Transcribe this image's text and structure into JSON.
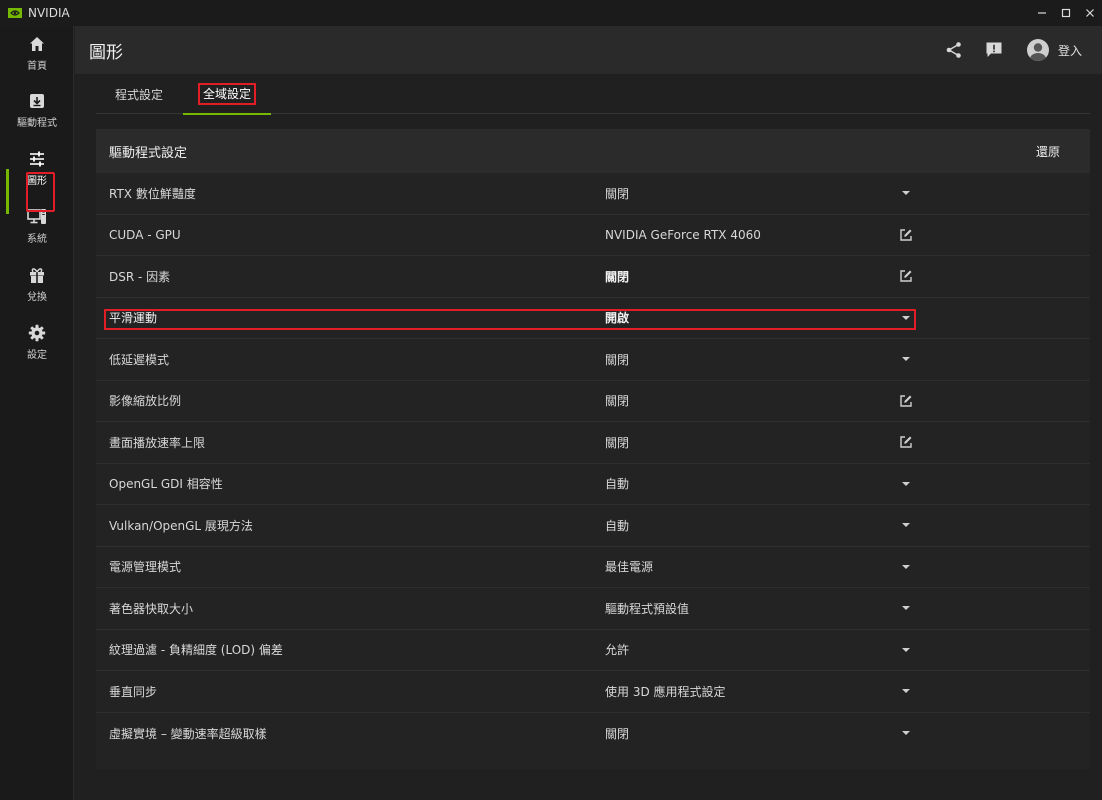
{
  "titlebar": {
    "app_name": "NVIDIA"
  },
  "sidebar": {
    "items": [
      {
        "label": "首頁",
        "icon": "home-icon"
      },
      {
        "label": "驅動程式",
        "icon": "driver-download-icon"
      },
      {
        "label": "圖形",
        "icon": "sliders-icon",
        "active": true
      },
      {
        "label": "系統",
        "icon": "monitor-system-icon"
      },
      {
        "label": "兌換",
        "icon": "gift-icon"
      },
      {
        "label": "設定",
        "icon": "gear-icon"
      }
    ]
  },
  "header": {
    "title": "圖形",
    "login_label": "登入"
  },
  "tabs": [
    {
      "label": "程式設定"
    },
    {
      "label": "全域設定",
      "active": true
    }
  ],
  "panel": {
    "title": "驅動程式設定",
    "restore_label": "還原",
    "rows": [
      {
        "label": "RTX 數位鮮豔度",
        "value": "關閉",
        "control": "dropdown"
      },
      {
        "label": "CUDA - GPU",
        "value": "NVIDIA GeForce RTX 4060",
        "control": "edit"
      },
      {
        "label": "DSR - 因素",
        "value": "關閉",
        "control": "edit",
        "bold": true
      },
      {
        "label": "平滑運動",
        "value": "開啟",
        "control": "dropdown",
        "bold": true,
        "highlighted": true
      },
      {
        "label": "低延遲模式",
        "value": "關閉",
        "control": "dropdown"
      },
      {
        "label": "影像縮放比例",
        "value": "關閉",
        "control": "edit"
      },
      {
        "label": "畫面播放速率上限",
        "value": "關閉",
        "control": "edit"
      },
      {
        "label": "OpenGL GDI 相容性",
        "value": "自動",
        "control": "dropdown"
      },
      {
        "label": "Vulkan/OpenGL 展現方法",
        "value": "自動",
        "control": "dropdown"
      },
      {
        "label": "電源管理模式",
        "value": "最佳電源",
        "control": "dropdown"
      },
      {
        "label": "著色器快取大小",
        "value": "驅動程式預設值",
        "control": "dropdown"
      },
      {
        "label": "紋理過濾 - 負精細度 (LOD) 偏差",
        "value": "允許",
        "control": "dropdown"
      },
      {
        "label": "垂直同步",
        "value": "使用 3D 應用程式設定",
        "control": "dropdown"
      },
      {
        "label": "虛擬實境 – 變動速率超級取樣",
        "value": "關閉",
        "control": "dropdown"
      }
    ]
  },
  "colors": {
    "accent": "#76b900",
    "highlight": "#e11d26"
  }
}
